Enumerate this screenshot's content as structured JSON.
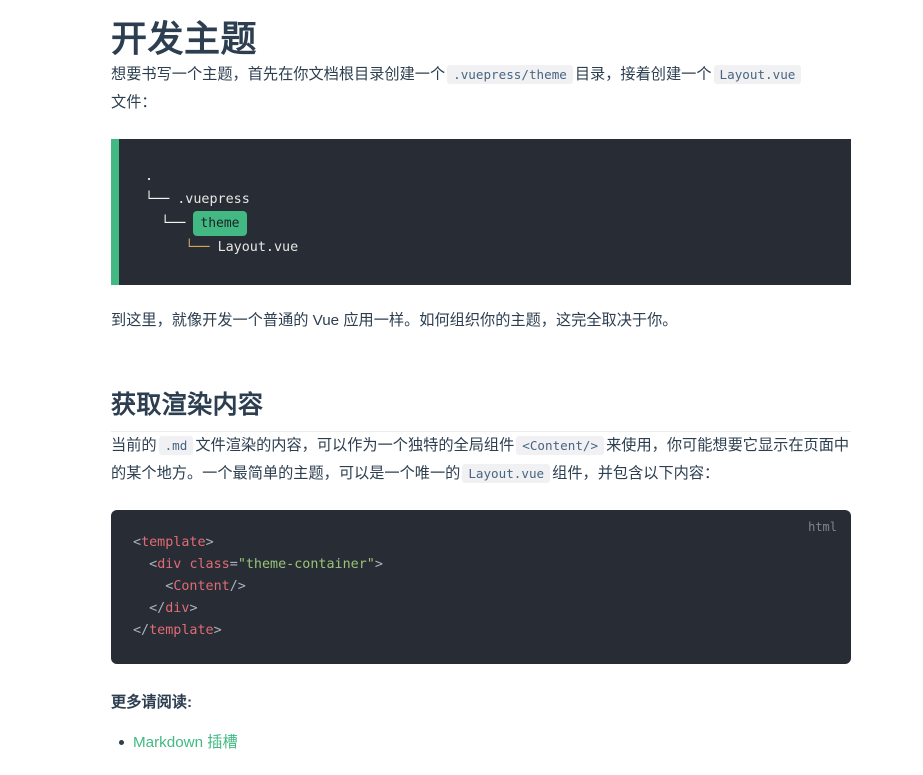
{
  "page": {
    "title": "开发主题",
    "intro": {
      "part1": "想要书写一个主题，首先在你文档根目录创建一个",
      "code1": ".vuepress/theme",
      "part2": "目录，接着创建一个",
      "code2": "Layout.vue",
      "part3": "文件："
    },
    "tree_block": {
      "border_color": "#42b983",
      "background": "#282c34",
      "lines": [
        {
          "prefix": ".",
          "badge": null,
          "name": null
        },
        {
          "prefix": "└── ",
          "badge": null,
          "name": ".vuepress"
        },
        {
          "prefix": "  └── ",
          "badge": "theme",
          "name": null
        },
        {
          "prefix": "     └── ",
          "badge": null,
          "name": "Layout.vue"
        }
      ],
      "raw": ".\n└── .vuepress\n   └── theme\n       └── Layout.vue"
    },
    "after_tree_para": "到这里，就像开发一个普通的 Vue 应用一样。如何组织你的主题，这完全取决于你。",
    "section2": {
      "heading": "获取渲染内容",
      "para": {
        "part1": "当前的",
        "code1": ".md",
        "part2": "文件渲染的内容，可以作为一个独特的全局组件",
        "code2": "<Content/>",
        "part3": "来使用，你可能想要它显示在页面中的某个地方。一个最简单的主题，可以是一个唯一的",
        "code3": "Layout.vue",
        "part4": "组件，并包含以下内容："
      }
    },
    "code_block": {
      "lang_label": "html",
      "background": "#282c34",
      "raw": "<template>\n  <div class=\"theme-container\">\n    <Content/>\n  </div>\n</template>",
      "lines": [
        [
          {
            "t": "<",
            "c": "punct"
          },
          {
            "t": "template",
            "c": "tag"
          },
          {
            "t": ">",
            "c": "punct"
          }
        ],
        [
          {
            "t": "  <",
            "c": "punct"
          },
          {
            "t": "div",
            "c": "tag"
          },
          {
            "t": " ",
            "c": "punct"
          },
          {
            "t": "class",
            "c": "attr"
          },
          {
            "t": "=",
            "c": "eq"
          },
          {
            "t": "\"theme-container\"",
            "c": "str"
          },
          {
            "t": ">",
            "c": "punct"
          }
        ],
        [
          {
            "t": "    <",
            "c": "punct"
          },
          {
            "t": "Content",
            "c": "tag"
          },
          {
            "t": "/>",
            "c": "punct"
          }
        ],
        [
          {
            "t": "  </",
            "c": "punct"
          },
          {
            "t": "div",
            "c": "tag"
          },
          {
            "t": ">",
            "c": "punct"
          }
        ],
        [
          {
            "t": "</",
            "c": "punct"
          },
          {
            "t": "template",
            "c": "tag"
          },
          {
            "t": ">",
            "c": "punct"
          }
        ]
      ]
    },
    "more_label": "更多请阅读:",
    "links": [
      {
        "label": "Markdown 插槽",
        "color": "#42b983"
      }
    ]
  }
}
